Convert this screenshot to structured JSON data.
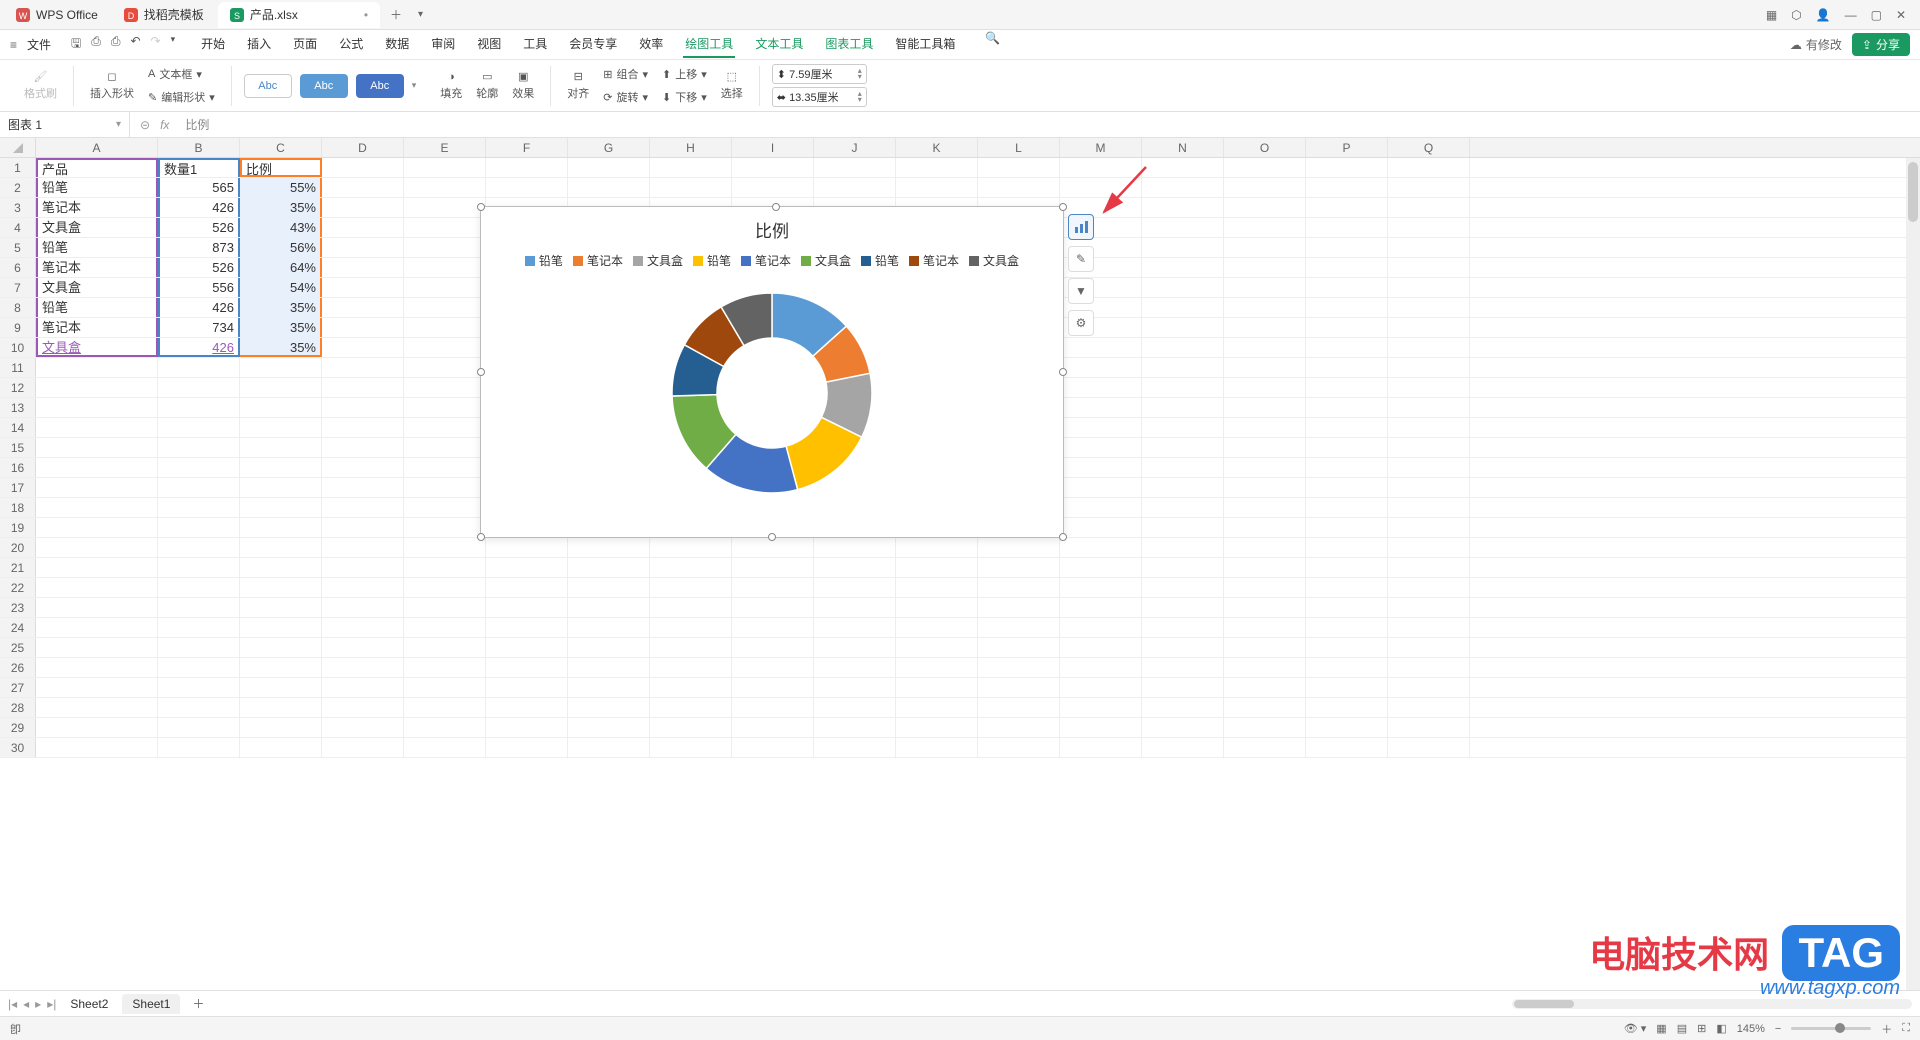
{
  "titlebar": {
    "tab1": "WPS Office",
    "tab2": "找稻壳模板",
    "tab3": "产品.xlsx"
  },
  "menu": {
    "file": "文件",
    "tabs": [
      "开始",
      "插入",
      "页面",
      "公式",
      "数据",
      "审阅",
      "视图",
      "工具",
      "会员专享",
      "效率",
      "绘图工具",
      "文本工具",
      "图表工具",
      "智能工具箱"
    ],
    "modify": "有修改",
    "share": "分享"
  },
  "ribbon": {
    "format_brush": "格式刷",
    "insert_shape": "插入形状",
    "text_box": "文本框",
    "edit_shape": "编辑形状",
    "abc": "Abc",
    "fill": "填充",
    "outline": "轮廓",
    "effect": "效果",
    "align": "对齐",
    "group": "组合",
    "ungroup": "",
    "rotate": "旋转",
    "move_up": "上移",
    "move_down": "下移",
    "select": "选择",
    "height_icon": "↕",
    "width_icon": "↔",
    "height": "7.59厘米",
    "width": "13.35厘米"
  },
  "formula": {
    "name": "图表 1",
    "value": "比例"
  },
  "columns": [
    "A",
    "B",
    "C",
    "D",
    "E",
    "F",
    "G",
    "H",
    "I",
    "J",
    "K",
    "L",
    "M",
    "N",
    "O",
    "P",
    "Q"
  ],
  "data": {
    "headers": {
      "a": "产品",
      "b": "数量1",
      "c": "比例"
    },
    "rows": [
      {
        "a": "铅笔",
        "b": "565",
        "c": "55%"
      },
      {
        "a": "笔记本",
        "b": "426",
        "c": "35%"
      },
      {
        "a": "文具盒",
        "b": "526",
        "c": "43%"
      },
      {
        "a": "铅笔",
        "b": "873",
        "c": "56%"
      },
      {
        "a": "笔记本",
        "b": "526",
        "c": "64%"
      },
      {
        "a": "文具盒",
        "b": "556",
        "c": "54%"
      },
      {
        "a": "铅笔",
        "b": "426",
        "c": "35%"
      },
      {
        "a": "笔记本",
        "b": "734",
        "c": "35%"
      },
      {
        "a": "文具盒",
        "b": "426",
        "c": "35%"
      }
    ]
  },
  "chart_data": {
    "type": "pie",
    "title": "比例",
    "categories": [
      "铅笔",
      "笔记本",
      "文具盒",
      "铅笔",
      "笔记本",
      "文具盒",
      "铅笔",
      "笔记本",
      "文具盒"
    ],
    "values": [
      55,
      35,
      43,
      56,
      64,
      54,
      35,
      35,
      35
    ],
    "colors": [
      "#5b9bd5",
      "#ed7d31",
      "#a5a5a5",
      "#ffc000",
      "#4472c4",
      "#70ad47",
      "#255e91",
      "#9e480e",
      "#636363"
    ]
  },
  "sheets": {
    "s1": "Sheet2",
    "s2": "Sheet1"
  },
  "status": {
    "zoom": "145%",
    "ready": "卽"
  },
  "watermark": {
    "line1": "电脑技术网",
    "tag": "TAG",
    "line2": "www.tagxp.com"
  }
}
